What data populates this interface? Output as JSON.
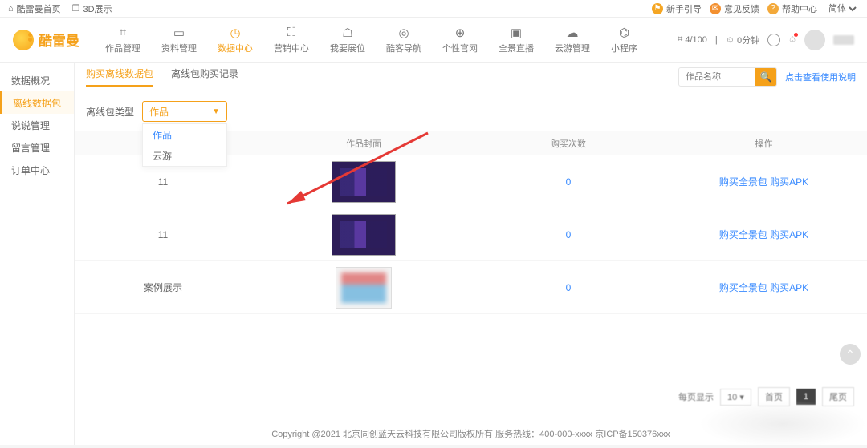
{
  "topbar": {
    "home": "酷雷曼首页",
    "threed": "3D展示",
    "guide": "新手引导",
    "feedback": "意见反馈",
    "help": "帮助中心",
    "lang": "简体"
  },
  "brand": "酷雷曼",
  "nav": [
    {
      "label": "作品管理",
      "icon": "⌗"
    },
    {
      "label": "资料管理",
      "icon": "▭"
    },
    {
      "label": "数据中心",
      "icon": "◷",
      "active": true
    },
    {
      "label": "营销中心",
      "icon": "⛶"
    },
    {
      "label": "我要展位",
      "icon": "☖"
    },
    {
      "label": "酷客导航",
      "icon": "◎"
    },
    {
      "label": "个性官网",
      "icon": "⊕"
    },
    {
      "label": "全景直播",
      "icon": "▣"
    },
    {
      "label": "云游管理",
      "icon": "☁"
    },
    {
      "label": "小程序",
      "icon": "⌬"
    }
  ],
  "header_right": {
    "quota_icon": "⌗",
    "quota": "4/100",
    "time_icon": "☺",
    "time": "0分钟"
  },
  "sidebar": [
    {
      "label": "数据概况"
    },
    {
      "label": "离线数据包",
      "active": true
    },
    {
      "label": "说说管理"
    },
    {
      "label": "留言管理"
    },
    {
      "label": "订单中心"
    }
  ],
  "tabs": [
    {
      "label": "购买离线数据包",
      "active": true
    },
    {
      "label": "离线包购买记录"
    }
  ],
  "search_placeholder": "作品名称",
  "help_link": "点击查看使用说明",
  "filter_label": "离线包类型",
  "select_value": "作品",
  "dropdown": [
    {
      "label": "作品",
      "active": true
    },
    {
      "label": "云游"
    }
  ],
  "columns": {
    "name": "",
    "cover": "作品封面",
    "count": "购买次数",
    "op": "操作"
  },
  "rows": [
    {
      "name": "11",
      "count": "0",
      "op1": "购买全景包",
      "op2": "购买APK",
      "coverClass": ""
    },
    {
      "name": "11",
      "count": "0",
      "op1": "购买全景包",
      "op2": "购买APK",
      "coverClass": ""
    },
    {
      "name": "案例展示",
      "count": "0",
      "op1": "购买全景包",
      "op2": "购买APK",
      "coverClass": "c3"
    }
  ],
  "pager": {
    "perpage_label": "每页显示",
    "perpage": "10",
    "first": "首页",
    "page": "1",
    "last": "尾页"
  },
  "footer": "Copyright @2021 北京同创蓝天云科技有限公司版权所有 服务热线：400-000-xxxx 京ICP备150376xxx"
}
